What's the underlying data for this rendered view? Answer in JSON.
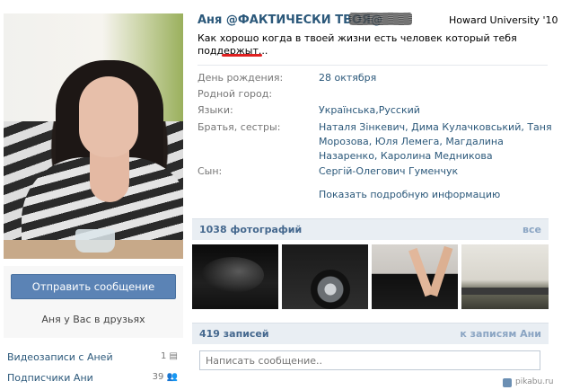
{
  "header": {
    "name": "Аня @ФАКТИЧЕСКИ ТВОЯ@",
    "university": "Howard University '10",
    "status": "Как хорошо когда в твоей жизни есть человек который тебя поддержыт..."
  },
  "sidebar": {
    "send_message": "Отправить сообщение",
    "friend_status": "Аня у Вас в друзьях",
    "links": [
      {
        "label": "Видеозаписи с Аней",
        "count": "1"
      },
      {
        "label": "Подписчики Ани",
        "count": "39"
      }
    ]
  },
  "info": [
    {
      "label": "День рождения:",
      "value": "28 октября"
    },
    {
      "label": "Родной город:",
      "value": ""
    },
    {
      "label": "Языки:",
      "value": "Українська,Русский"
    },
    {
      "label": "Братья, сестры:",
      "value": "Наталя Зінкевич, Дима Кулачковський, Таня Морозова, Юля Лемега, Магдалина Назаренко, Каролина Медникова"
    },
    {
      "label": "Сын:",
      "value": "Сергій-Олегович Гуменчук"
    }
  ],
  "show_more": "Показать подробную информацию",
  "photos": {
    "title": "1038 фотографий",
    "link": "все",
    "thumbs": [
      "photo-car-hood",
      "photo-car-wheel",
      "photo-legs-on-car",
      "photo-road-landscape"
    ]
  },
  "posts": {
    "title": "419 записей",
    "link": "к записям Ани",
    "input_placeholder": "Написать сообщение.."
  },
  "watermark": "pikabu.ru",
  "colors": {
    "link": "#2b587a",
    "button": "#5b83b5",
    "section_header_bg": "#e9eef3",
    "annotation_red": "#e02020"
  }
}
